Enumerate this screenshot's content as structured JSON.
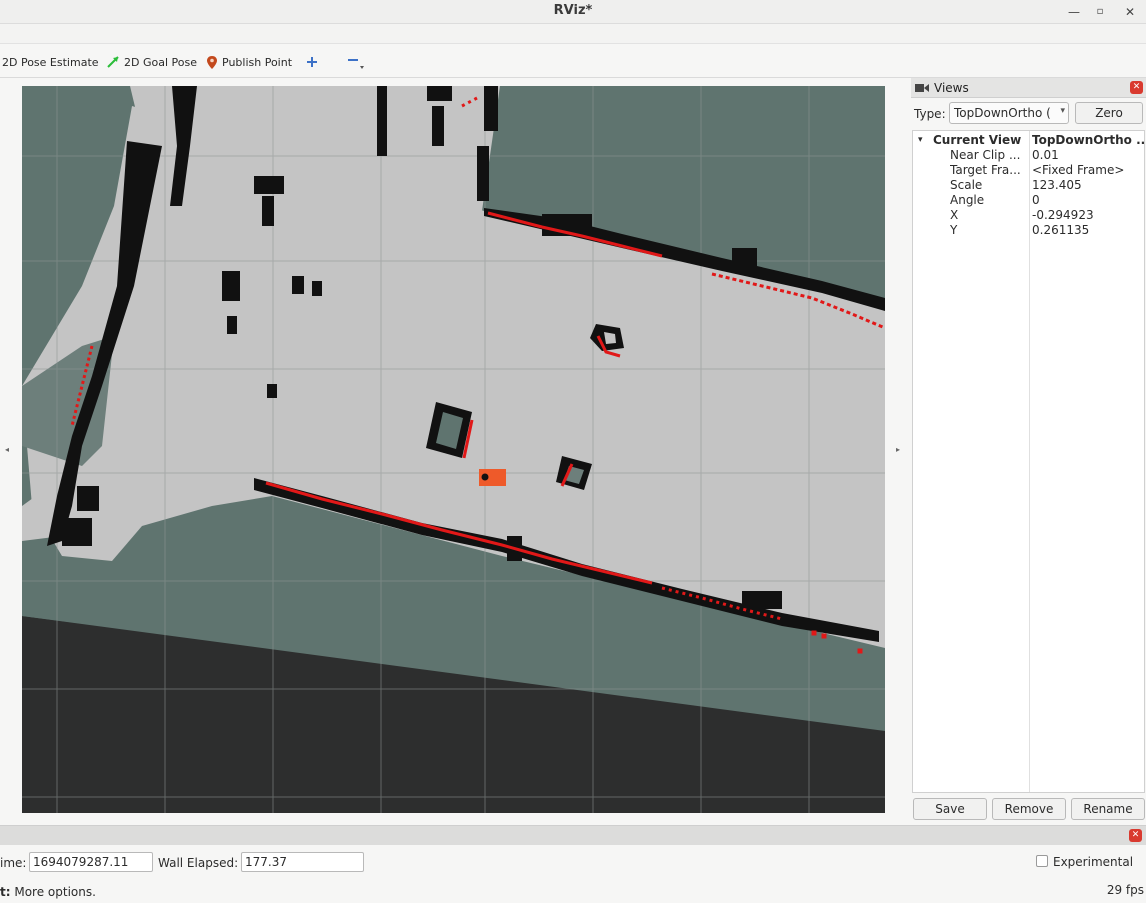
{
  "window": {
    "title": "RViz*"
  },
  "toolbar": {
    "pose_estimate": "2D Pose Estimate",
    "goal_pose": "2D Goal Pose",
    "publish_point": "Publish Point"
  },
  "views": {
    "title": "Views",
    "type_label": "Type:",
    "type_value": "TopDownOrtho (",
    "zero": "Zero",
    "properties": [
      {
        "key": "Current View",
        "value": "TopDownOrtho ..."
      },
      {
        "key": "Near Clip ...",
        "value": "0.01"
      },
      {
        "key": "Target Fra...",
        "value": "<Fixed Frame>"
      },
      {
        "key": "Scale",
        "value": "123.405"
      },
      {
        "key": "Angle",
        "value": "0"
      },
      {
        "key": "X",
        "value": "-0.294923"
      },
      {
        "key": "Y",
        "value": "0.261135"
      }
    ],
    "save": "Save",
    "remove": "Remove",
    "rename": "Rename"
  },
  "time": {
    "ros_time_label": "ime:",
    "ros_time_value": "1694079287.11",
    "wall_elapsed_label": "Wall Elapsed:",
    "wall_elapsed_value": "177.37",
    "experimental": "Experimental"
  },
  "status": {
    "hint_bold": "t:",
    "hint_text": " More options.",
    "fps": "29 fps"
  },
  "colors": {
    "map_free": "#c4c4c4",
    "map_unknown": "#5f746f",
    "map_outside": "#2d2e2e",
    "obstacle": "#111111",
    "laser_scan": "#e11818",
    "robot": "#ee5a2a"
  }
}
